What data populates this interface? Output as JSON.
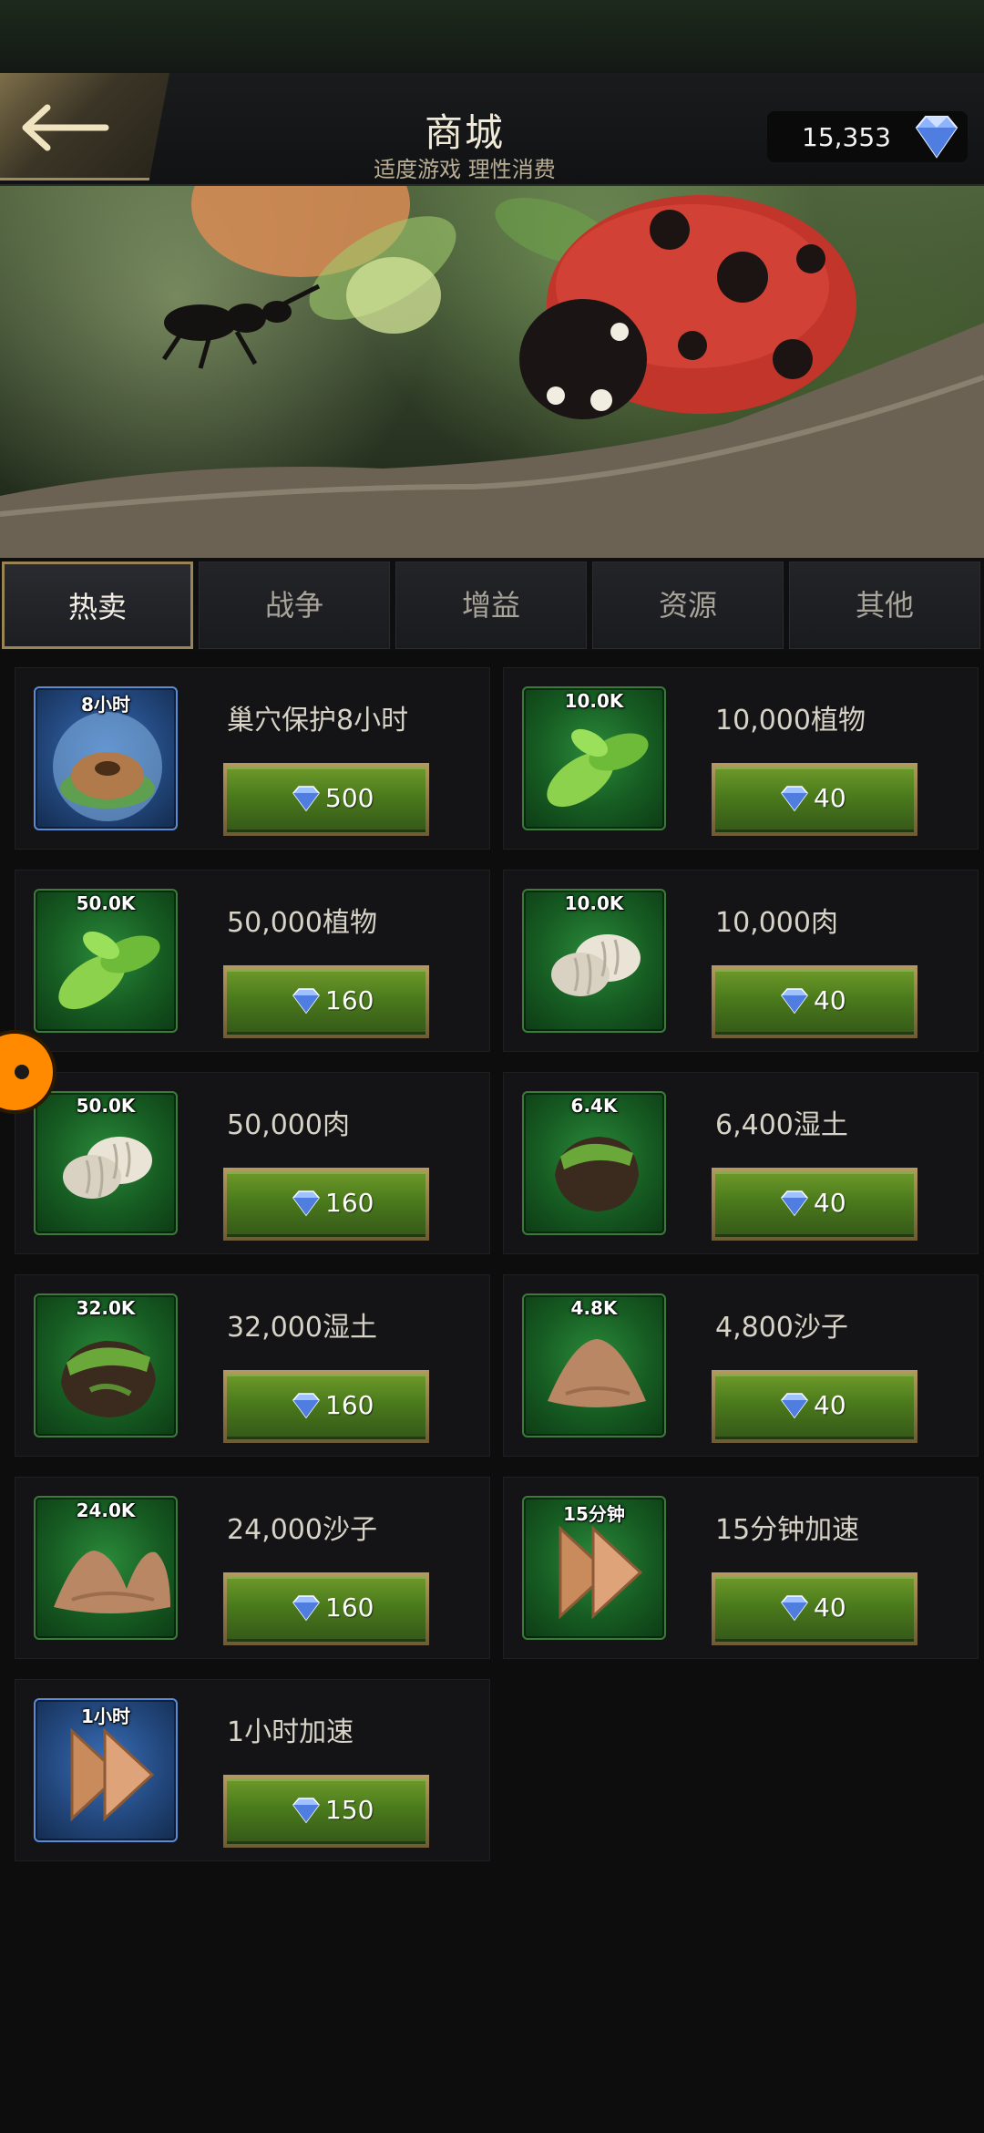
{
  "header": {
    "title": "商城",
    "subtitle": "适度游戏 理性消费",
    "currency_value": "15,353",
    "currency_icon": "diamond-icon"
  },
  "tabs": [
    {
      "label": "热卖",
      "active": true
    },
    {
      "label": "战争",
      "active": false
    },
    {
      "label": "增益",
      "active": false
    },
    {
      "label": "资源",
      "active": false
    },
    {
      "label": "其他",
      "active": false
    }
  ],
  "items": [
    {
      "qty": "8小时",
      "name": "巢穴保护8小时",
      "price": "500",
      "icon": "nest-shield-icon"
    },
    {
      "qty": "10.0K",
      "name": "10,000植物",
      "price": "40",
      "icon": "leaf-icon"
    },
    {
      "qty": "50.0K",
      "name": "50,000植物",
      "price": "160",
      "icon": "leaf-icon"
    },
    {
      "qty": "10.0K",
      "name": "10,000肉",
      "price": "40",
      "icon": "larva-icon"
    },
    {
      "qty": "50.0K",
      "name": "50,000肉",
      "price": "160",
      "icon": "larva-icon"
    },
    {
      "qty": "6.4K",
      "name": "6,400湿土",
      "price": "40",
      "icon": "wet-soil-icon"
    },
    {
      "qty": "32.0K",
      "name": "32,000湿土",
      "price": "160",
      "icon": "wet-soil-icon"
    },
    {
      "qty": "4.8K",
      "name": "4,800沙子",
      "price": "40",
      "icon": "sand-icon"
    },
    {
      "qty": "24.0K",
      "name": "24,000沙子",
      "price": "160",
      "icon": "sand-icon"
    },
    {
      "qty": "15分钟",
      "name": "15分钟加速",
      "price": "40",
      "icon": "speedup-icon"
    },
    {
      "qty": "1小时",
      "name": "1小时加速",
      "price": "150",
      "icon": "speedup-icon"
    }
  ],
  "colors": {
    "accent_gold": "#9a8455",
    "button_green": "#4b7a1c",
    "icon_green": "#165b22",
    "icon_blue": "#23487e"
  }
}
